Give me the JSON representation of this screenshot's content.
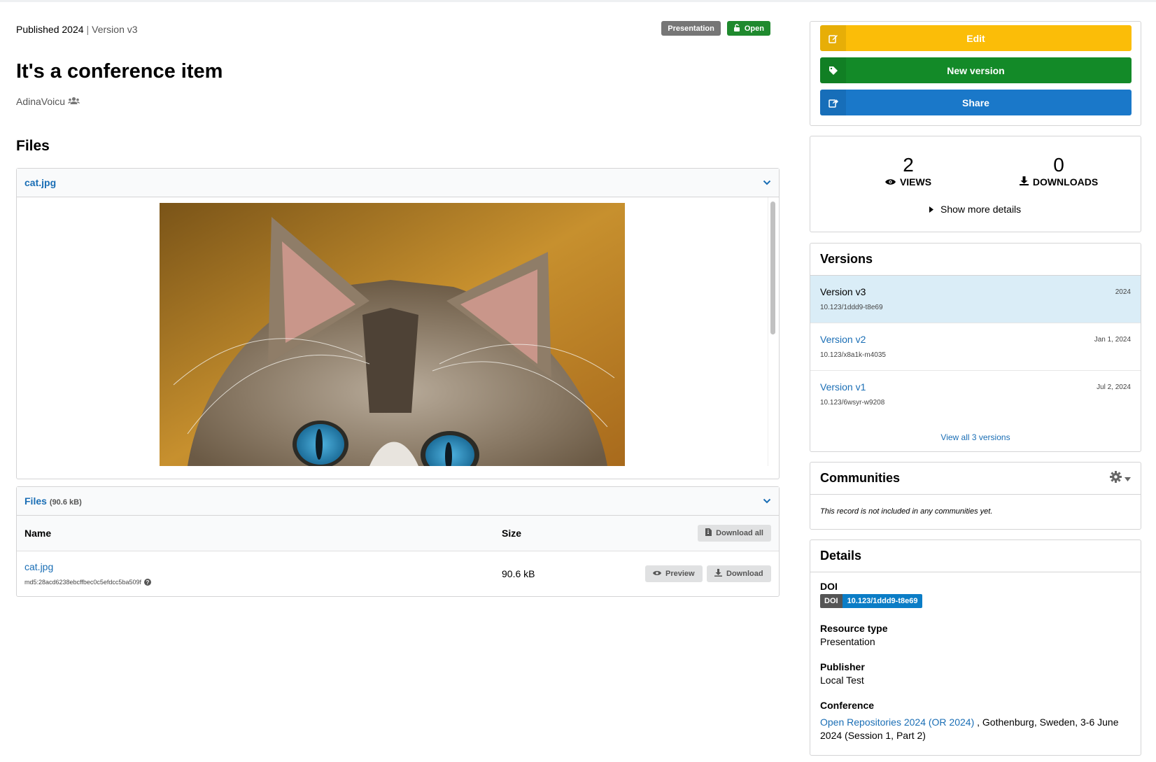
{
  "header": {
    "published": "Published 2024",
    "separator": "|",
    "version": "Version v3",
    "badges": {
      "type": "Presentation",
      "access": "Open"
    }
  },
  "record": {
    "title": "It's a conference item",
    "creator": "AdinaVoicu"
  },
  "files_section": {
    "heading": "Files",
    "preview_file": "cat.jpg",
    "table": {
      "title": "Files",
      "total_size": "(90.6 kB)",
      "col_name": "Name",
      "col_size": "Size",
      "download_all": "Download all",
      "rows": [
        {
          "name": "cat.jpg",
          "checksum": "md5:28acd6238ebcffbec0c5efdcc5ba509f",
          "size": "90.6 kB",
          "preview_label": "Preview",
          "download_label": "Download"
        }
      ]
    }
  },
  "actions": {
    "edit": "Edit",
    "new_version": "New version",
    "share": "Share"
  },
  "stats": {
    "views": "2",
    "views_label": "VIEWS",
    "downloads": "0",
    "downloads_label": "DOWNLOADS",
    "show_more": "Show more details"
  },
  "versions": {
    "heading": "Versions",
    "items": [
      {
        "title": "Version v3",
        "doi": "10.123/1ddd9-t8e69",
        "date": "2024"
      },
      {
        "title": "Version v2",
        "doi": "10.123/x8a1k-m4035",
        "date": "Jan 1, 2024"
      },
      {
        "title": "Version v1",
        "doi": "10.123/6wsyr-w9208",
        "date": "Jul 2, 2024"
      }
    ],
    "view_all": "View all 3 versions"
  },
  "communities": {
    "heading": "Communities",
    "empty_text": "This record is not included in any communities yet."
  },
  "details": {
    "heading": "Details",
    "doi_label": "DOI",
    "doi_badge_left": "DOI",
    "doi_value": "10.123/1ddd9-t8e69",
    "resource_type_label": "Resource type",
    "resource_type": "Presentation",
    "publisher_label": "Publisher",
    "publisher": "Local Test",
    "conference_label": "Conference",
    "conference_link": "Open Repositories 2024 (OR 2024)",
    "conference_rest": " , Gothenburg, Sweden, 3-6 June",
    "conference_rest2": "2024 (Session 1, Part 2)"
  },
  "colors": {
    "edit": "#fbbd08",
    "new_version": "#138a28",
    "share": "#1a78c9",
    "open_badge": "#1f8a2e",
    "type_badge": "#767676",
    "link": "#1a6eb5",
    "active_version_bg": "#daedf7"
  }
}
